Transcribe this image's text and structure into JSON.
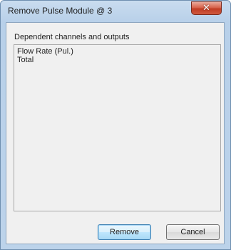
{
  "window": {
    "title": "Remove Pulse Module @ 3",
    "close_icon": "close-icon",
    "close_glyph": "✕"
  },
  "dependents": {
    "label": "Dependent channels and outputs",
    "items": [
      "Flow Rate (Pul.)",
      "Total"
    ]
  },
  "buttons": {
    "remove_label": "Remove",
    "cancel_label": "Cancel"
  },
  "colors": {
    "close_button_red": "#c13d24",
    "default_button_border": "#3c7fb1",
    "frame_blue": "#bcd3ea"
  }
}
